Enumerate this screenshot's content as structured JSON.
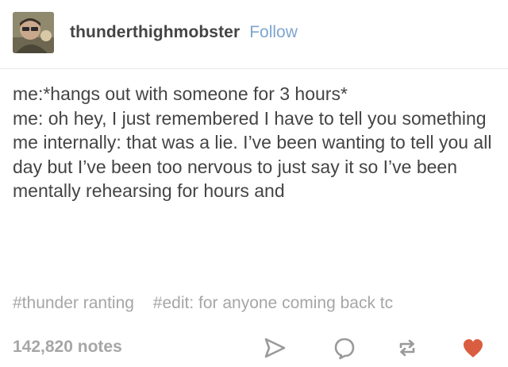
{
  "post": {
    "username": "thunderthighmobster",
    "follow_label": "Follow",
    "lines": [
      "me:*hangs out with someone for 3 hours*",
      "me: oh hey, I just remembered I have to tell you something",
      "me internally: that was a lie. I’ve been wanting to tell you all day but I’ve been too nervous to just say it so I’ve been mentally rehearsing for hours and"
    ],
    "tags": [
      "#thunder ranting",
      "#edit: for anyone coming back tc"
    ],
    "notes": "142,820 notes"
  },
  "icons": {
    "share": "paper-plane-icon",
    "reply": "speech-bubble-icon",
    "reblog": "reblog-arrows-icon",
    "like": "heart-icon"
  },
  "colors": {
    "text": "#444444",
    "follow": "#7fa6cf",
    "muted": "#a6a6a6",
    "icon": "#9a9a9a",
    "heart": "#d95e40"
  }
}
